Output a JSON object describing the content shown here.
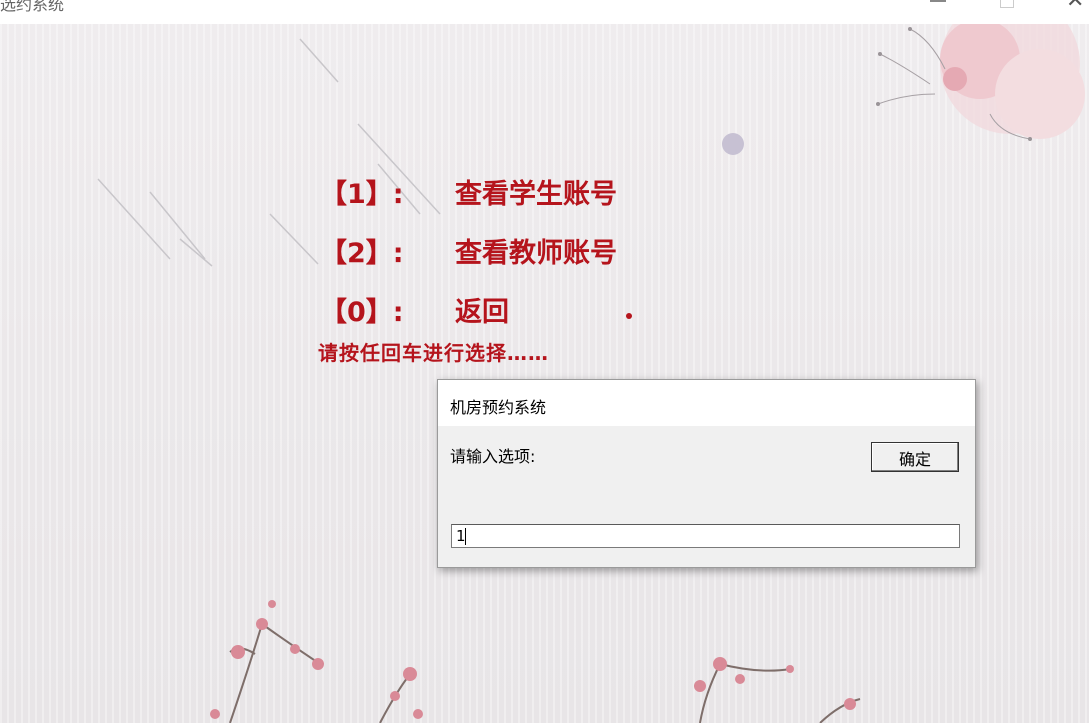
{
  "window": {
    "title": "选约系统"
  },
  "menu": {
    "items": [
      {
        "key": "【1】:",
        "label": "查看学生账号"
      },
      {
        "key": "【2】:",
        "label": "查看教师账号"
      },
      {
        "key": "【0】:",
        "label": "返回"
      }
    ],
    "prompt": "请按任回车进行选择……"
  },
  "dialog": {
    "title": "机房预约系统",
    "label": "请输入选项:",
    "ok_label": "确定",
    "input_value": "1"
  },
  "colors": {
    "menu_text": "#b5141c",
    "background": "#ebe8ea",
    "dialog_bg": "#f0f0f0"
  }
}
